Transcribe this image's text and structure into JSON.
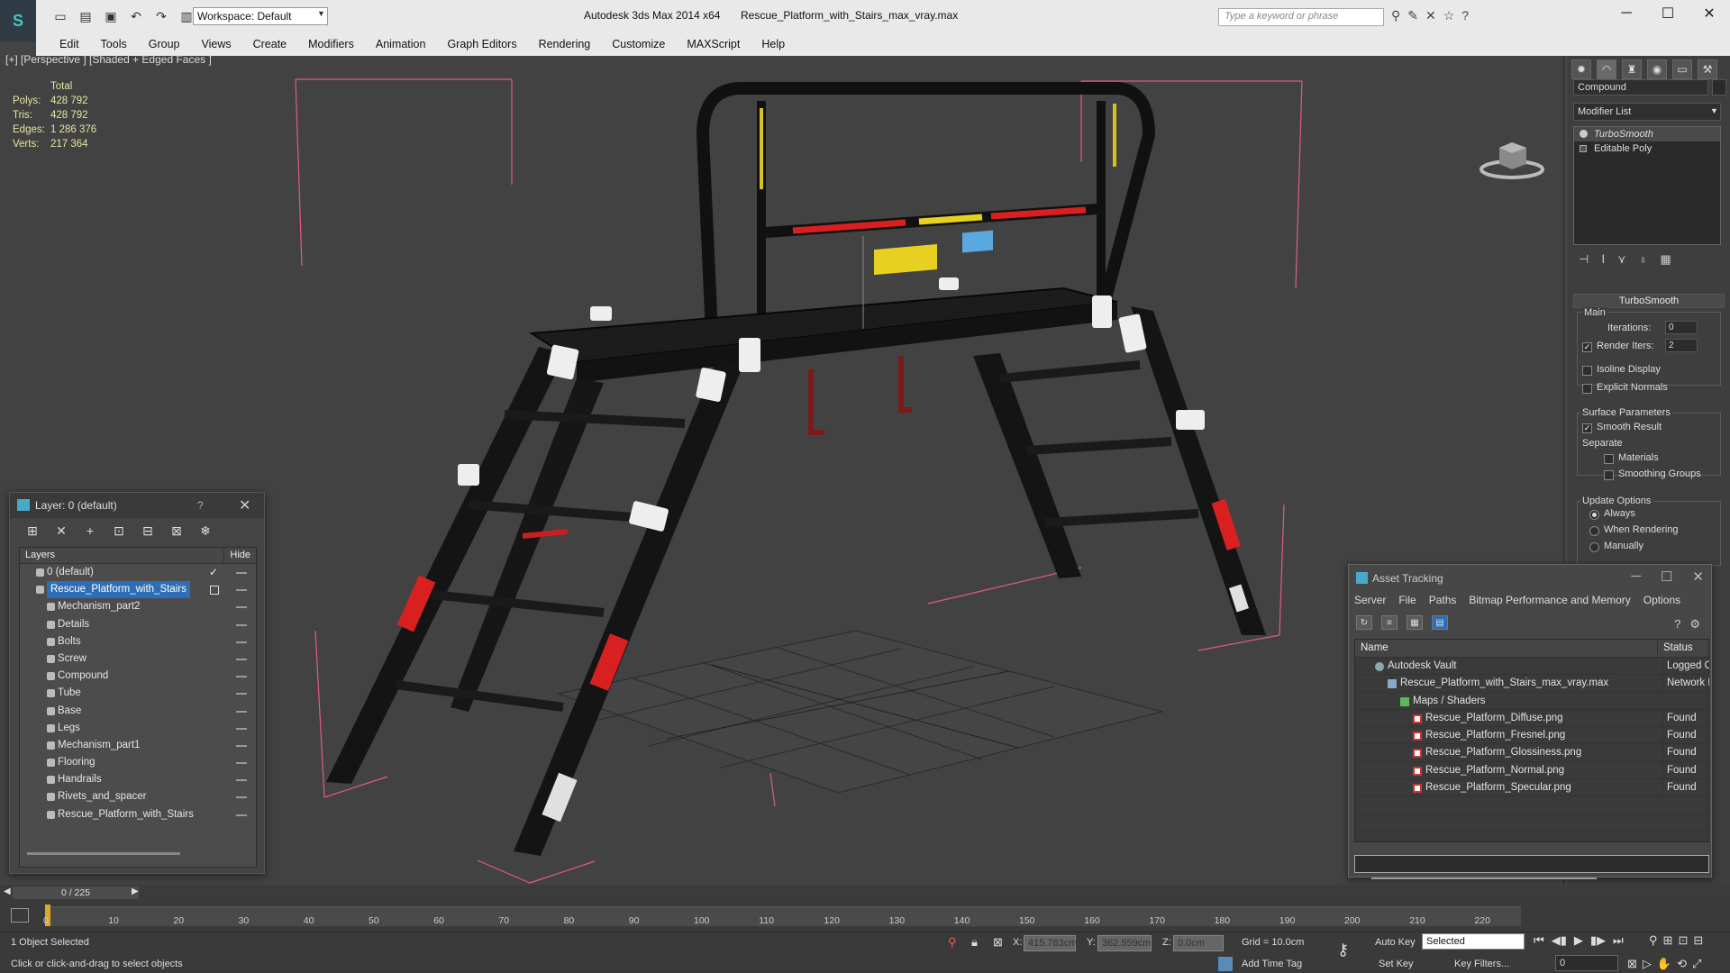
{
  "titlebar": {
    "workspace": "Workspace: Default",
    "app_title": "Autodesk 3ds Max  2014 x64",
    "file_title": "Rescue_Platform_with_Stairs_max_vray.max",
    "search_placeholder": "Type a keyword or phrase"
  },
  "menu": [
    "Edit",
    "Tools",
    "Group",
    "Views",
    "Create",
    "Modifiers",
    "Animation",
    "Graph Editors",
    "Rendering",
    "Customize",
    "MAXScript",
    "Help"
  ],
  "viewport": {
    "label": "[+] [Perspective ] [Shaded + Edged Faces ]",
    "stats": {
      "total_label": "Total",
      "rows": [
        {
          "label": "Polys:",
          "value": "428 792"
        },
        {
          "label": "Tris:",
          "value": "428 792"
        },
        {
          "label": "Edges:",
          "value": "1 286 376"
        },
        {
          "label": "Verts:",
          "value": "217 364"
        }
      ]
    }
  },
  "command_panel": {
    "object_name": "Compound",
    "modifier_list": "Modifier List",
    "stack": [
      "TurboSmooth",
      "Editable Poly"
    ],
    "rollout_title": "TurboSmooth",
    "main_label": "Main",
    "iterations_label": "Iterations:",
    "iterations_value": "0",
    "render_iters_label": "Render Iters:",
    "render_iters_value": "2",
    "isoline_label": "Isoline Display",
    "explicit_label": "Explicit Normals",
    "surface_label": "Surface Parameters",
    "smooth_result_label": "Smooth Result",
    "separate_label": "Separate",
    "materials_label": "Materials",
    "smoothing_label": "Smoothing Groups",
    "update_label": "Update Options",
    "always_label": "Always",
    "when_rendering_label": "When Rendering",
    "manually_label": "Manually"
  },
  "layer_dialog": {
    "title": "Layer: 0 (default)",
    "help": "?",
    "col_layers": "Layers",
    "col_hide": "Hide",
    "layers": [
      {
        "name": "0 (default)",
        "level": 0
      },
      {
        "name": "Rescue_Platform_with_Stairs",
        "level": 0,
        "selected": true
      },
      {
        "name": "Mechanism_part2",
        "level": 1
      },
      {
        "name": "Details",
        "level": 1
      },
      {
        "name": "Bolts",
        "level": 1
      },
      {
        "name": "Screw",
        "level": 1
      },
      {
        "name": "Compound",
        "level": 1
      },
      {
        "name": "Tube",
        "level": 1
      },
      {
        "name": "Base",
        "level": 1
      },
      {
        "name": "Legs",
        "level": 1
      },
      {
        "name": "Mechanism_part1",
        "level": 1
      },
      {
        "name": "Flooring",
        "level": 1
      },
      {
        "name": "Handrails",
        "level": 1
      },
      {
        "name": "Rivets_and_spacer",
        "level": 1
      },
      {
        "name": "Rescue_Platform_with_Stairs",
        "level": 1
      }
    ]
  },
  "asset_dialog": {
    "title": "Asset Tracking",
    "menu": [
      "Server",
      "File",
      "Paths",
      "Bitmap Performance and Memory",
      "Options"
    ],
    "col_name": "Name",
    "col_status": "Status",
    "rows": [
      {
        "name": "Autodesk Vault",
        "status": "Logged O",
        "indent": 1,
        "icon": "vault"
      },
      {
        "name": "Rescue_Platform_with_Stairs_max_vray.max",
        "status": "Network F",
        "indent": 2,
        "icon": "max"
      },
      {
        "name": "Maps / Shaders",
        "status": "",
        "indent": 3,
        "icon": "folder"
      },
      {
        "name": "Rescue_Platform_Diffuse.png",
        "status": "Found",
        "indent": 4,
        "icon": "png"
      },
      {
        "name": "Rescue_Platform_Fresnel.png",
        "status": "Found",
        "indent": 4,
        "icon": "png"
      },
      {
        "name": "Rescue_Platform_Glossiness.png",
        "status": "Found",
        "indent": 4,
        "icon": "png"
      },
      {
        "name": "Rescue_Platform_Normal.png",
        "status": "Found",
        "indent": 4,
        "icon": "png"
      },
      {
        "name": "Rescue_Platform_Specular.png",
        "status": "Found",
        "indent": 4,
        "icon": "png"
      }
    ]
  },
  "timeline": {
    "slider": "0 / 225",
    "ticks": [
      "0",
      "10",
      "20",
      "30",
      "40",
      "50",
      "60",
      "70",
      "80",
      "90",
      "100",
      "110",
      "120",
      "130",
      "140",
      "150",
      "160",
      "170",
      "180",
      "190",
      "200",
      "210",
      "220"
    ]
  },
  "status": {
    "selection": "1 Object Selected",
    "prompt": "Click or click-and-drag to select objects",
    "x_label": "X:",
    "x_value": "415.763cm",
    "y_label": "Y:",
    "y_value": "362.559cm",
    "z_label": "Z:",
    "z_value": "0.0cm",
    "grid": "Grid = 10.0cm",
    "add_time_tag": "Add Time Tag",
    "auto_key": "Auto Key",
    "set_key": "Set Key",
    "selected": "Selected",
    "key_filters": "Key Filters...",
    "frame": "0"
  },
  "colors": {
    "selection_blue": "#2d6eb6",
    "bbox_pink": "#e05a8a",
    "stats_yellow": "#e6e6a0",
    "accent_red": "#d82020",
    "accent_yellow": "#e8d020"
  }
}
